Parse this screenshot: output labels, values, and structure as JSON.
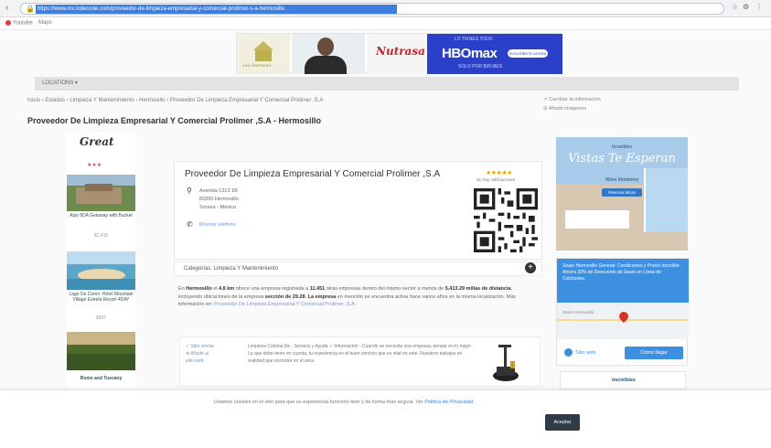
{
  "browser": {
    "url": "https://www.mx.lodecode.com/proveedor-de-limpieza-empresarial-y-comercial-prolimer-s-a-hermosillo",
    "bookmarks": [
      "Youtube",
      "Maps"
    ]
  },
  "top_ad": {
    "house_label": "LOS CRISTALES",
    "logo_text": "Nutrasa",
    "hbo_small": "LO TIENES TODO",
    "hbo_brand": "HBOmax",
    "hbo_button": "SUSCRÍBETE AHORA",
    "hbo_sub": "SOLO POR $99 MES"
  },
  "category_bar": "LOCATIONS ▾",
  "breadcrumb": "Inicio › Estados › Limpieza Y Mantenimiento › Hermosillo › Proveedor De Limpieza Empresarial Y Comercial Prolimer ,S.A",
  "side_links": [
    "↗ Cambiar la información",
    "⊘ Añadir imágenes"
  ],
  "page_title": "Proveedor De Limpieza Empresarial Y Comercial Prolimer ,S.A - Hermosillo",
  "left_ad": {
    "logo": "Great",
    "stars": "★★★",
    "items": [
      {
        "caption": "Alps 8DA Getaway with Bucket",
        "price": "$1.415"
      },
      {
        "caption": "Lago De Como: Hotel Mountain Village Estrela Resort 4DAY",
        "price": "$897"
      },
      {
        "caption": "Rome and Tuscany",
        "price": ""
      }
    ]
  },
  "business": {
    "name": "Proveedor De Limpieza Empresarial Y Comercial Prolimer ,S.A",
    "address_lines": [
      "Avenida 1313 1B",
      "83200 Hermosillo",
      "Sonora - México"
    ],
    "phone_link": "Mostrar teléfono",
    "rating_stars": "★★★★★",
    "rating_count": "No hay calificaciones",
    "category_label": "Categorías:",
    "category_value": "Limpieza Y Mantenimiento",
    "description_parts": [
      "En ",
      "Hermosillo",
      " el ",
      "4.8 km",
      " ofrece una empresa registrada a ",
      "11.451",
      " otras empresas dentro del mismo sector a menos de ",
      "5.413.29 millas de distancia",
      ", incluyendo ubicaciones de la empresa ",
      "sección de 29.28",
      ". ",
      "La empresa",
      " en mención se encuentra activa hace varios años en la misma localización. Más información en: ",
      "Proveedor De Limpieza Empresarial Y Comercial Prolimer ,S.A"
    ],
    "similar_tags": [
      "✓ Sitio similar",
      "⊕ Añadir al",
      "sitio web"
    ],
    "similar_text": "Limpieza Colonia De - Servicio y Ayuda ✓ Información - Cuando se necesita una empresa, pensar en lo mejor. Lo que debe tener en cuenta, tu experiencia en el buen servicio que es vital en este. Nuestros trabajos en realidad que encontré en el área."
  },
  "right_ads": {
    "hotel_small": "Increíbles",
    "hotel_script": "Vistas Te Esperan",
    "hotel_sub": "Hilton Monterrey",
    "hotel_button": "Reserva ahora",
    "map_head": "Sears Hermosillo General: Condiciones y Precio Increíble. Ahorra 30% de Descuento de Sears en Línea de Colchones.",
    "map_label": "Sears Hermosillo",
    "map_btn_1": "Sitio web",
    "map_btn_2": "Cómo llegar",
    "bottom_ad": "Increíbles"
  },
  "cookie": {
    "text": "Usamos cookies en el sitio para que su experiencia funcione bien y de forma más segura. Ver ",
    "link": "Política de Privacidad",
    "accept": "Aceptar"
  },
  "colors": {
    "url_highlight": "#3d7ee0",
    "hbo_blue": "#2a40c9",
    "accent_blue": "#3d8fe0",
    "star_gold": "#f0a500",
    "accept_dark": "#2f3b46"
  }
}
